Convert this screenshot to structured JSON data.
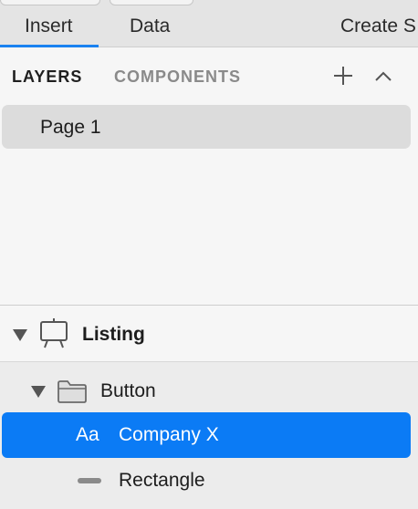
{
  "toolbar": {
    "tabs": [
      {
        "label": "Insert",
        "active": true
      },
      {
        "label": "Data",
        "active": false
      },
      {
        "label": "Create S",
        "active": false
      }
    ],
    "accent_color": "#1a82f0"
  },
  "layers_panel": {
    "header": {
      "layers_tab": "LAYERS",
      "components_tab": "COMPONENTS",
      "add_icon": "plus-icon",
      "collapse_icon": "chevron-up-icon"
    },
    "pages": [
      {
        "label": "Page 1",
        "selected": true
      }
    ],
    "tree": {
      "artboard": {
        "label": "Listing",
        "icon": "artboard-icon",
        "expanded": true
      },
      "group": {
        "label": "Button",
        "icon": "folder-icon",
        "expanded": true
      },
      "text_layer": {
        "label": "Company X",
        "icon_text": "Aa",
        "selected": true
      },
      "shape_layer": {
        "label": "Rectangle",
        "icon": "rectangle-icon"
      }
    },
    "selection_color": "#0b7bf5"
  }
}
